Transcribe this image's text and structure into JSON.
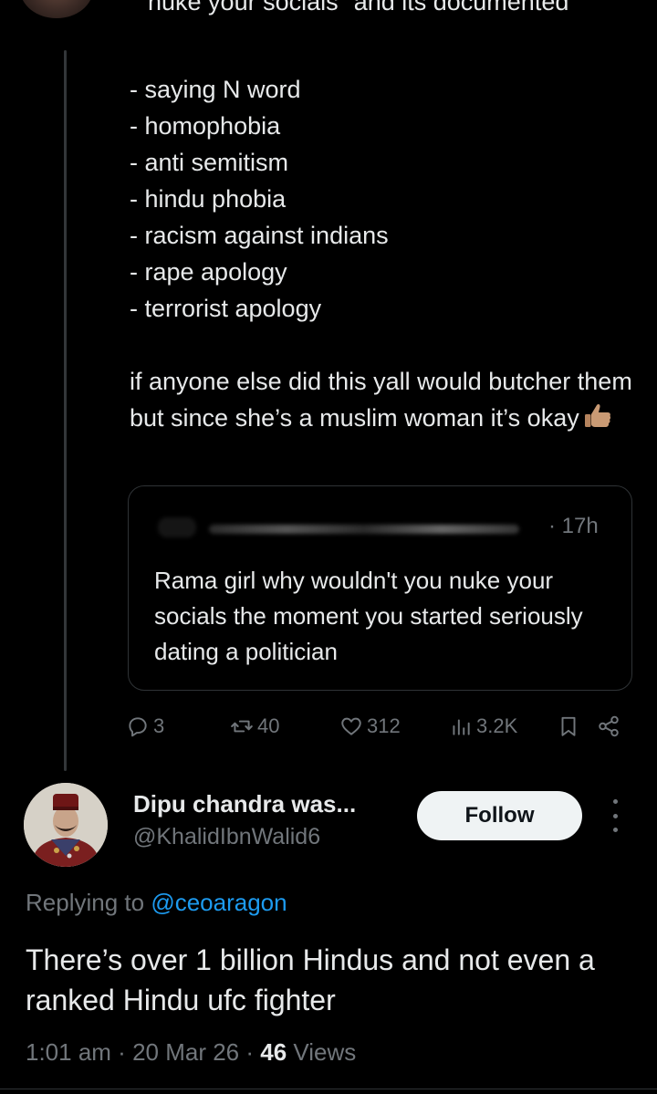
{
  "parent_tweet": {
    "cut_line": "nuke your socials\" and its documented",
    "list": [
      "- saying N word",
      "- homophobia",
      "- anti semitism",
      "- hindu phobia",
      "- racism against indians",
      "- rape apology",
      "- terrorist apology"
    ],
    "closing": "if anyone else did this yall would butcher them but since she’s a muslim woman it’s okay",
    "emoji": "thumbs-up-emoji"
  },
  "quoted_tweet": {
    "time": "· 17h",
    "text": "Rama girl why wouldn't you nuke your socials the moment you started seriously dating a politician"
  },
  "actions": {
    "replies": "3",
    "reposts": "40",
    "likes": "312",
    "views": "3.2K"
  },
  "reply_tweet": {
    "display_name": "Dipu chandra was...",
    "handle": "@KhalidIbnWalid6",
    "follow_label": "Follow",
    "replying_prefix": "Replying to",
    "replying_mention": "@ceoaragon",
    "text": "There’s over 1 billion Hindus and not even a ranked Hindu ufc fighter",
    "time": "1:01 am",
    "date": "20 Mar 26",
    "views_count": "46",
    "views_label": "Views"
  },
  "colors": {
    "background": "#000000",
    "text": "#e7e9ea",
    "muted": "#71767b",
    "link": "#1d9bf0",
    "border": "#2f3336"
  }
}
